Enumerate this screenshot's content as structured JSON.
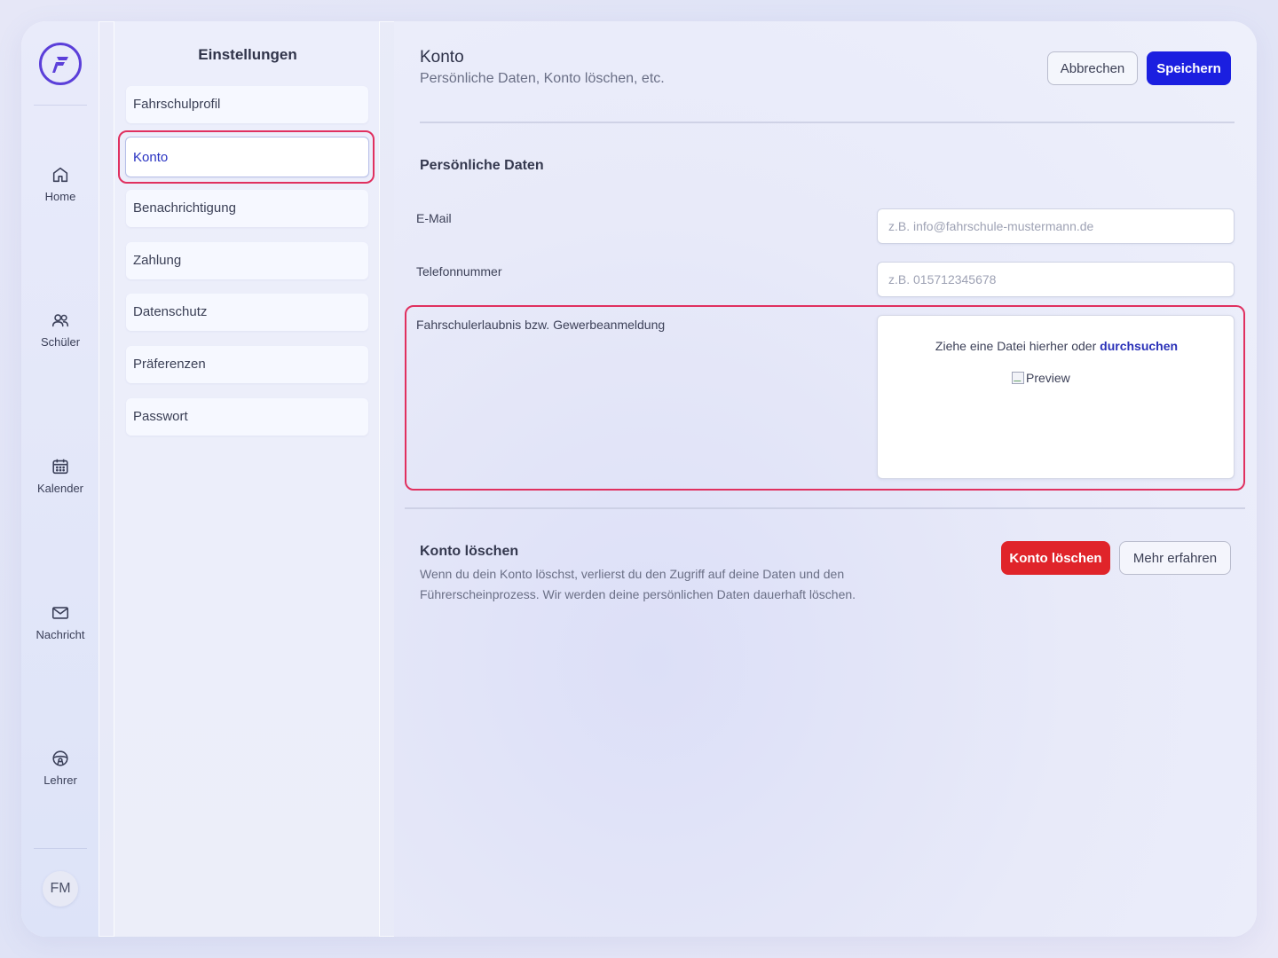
{
  "nav": {
    "items": [
      {
        "label": "Home",
        "icon": "home-icon"
      },
      {
        "label": "Schüler",
        "icon": "users-icon"
      },
      {
        "label": "Kalender",
        "icon": "calendar-icon"
      },
      {
        "label": "Nachricht",
        "icon": "mail-icon"
      },
      {
        "label": "Lehrer",
        "icon": "steering-wheel-icon"
      }
    ],
    "avatar_initials": "FM"
  },
  "settings": {
    "title": "Einstellungen",
    "items": [
      {
        "label": "Fahrschulprofil"
      },
      {
        "label": "Konto",
        "active": true
      },
      {
        "label": "Benachrichtigung"
      },
      {
        "label": "Zahlung"
      },
      {
        "label": "Datenschutz"
      },
      {
        "label": "Präferenzen"
      },
      {
        "label": "Passwort"
      }
    ]
  },
  "main": {
    "title": "Konto",
    "subtitle": "Persönliche Daten, Konto löschen, etc.",
    "cancel_label": "Abbrechen",
    "save_label": "Speichern",
    "personal": {
      "title": "Persönliche Daten",
      "email_label": "E-Mail",
      "email_placeholder": "z.B. info@fahrschule-mustermann.de",
      "phone_label": "Telefonnummer",
      "phone_placeholder": "z.B. 015712345678",
      "upload_label": "Fahrschulerlaubnis bzw. Gewerbeanmeldung",
      "upload_text": "Ziehe eine Datei hierher oder",
      "upload_link": "durchsuchen",
      "preview_alt": "Preview"
    },
    "delete": {
      "title": "Konto löschen",
      "description": "Wenn du dein Konto löschst, verlierst du den Zugriff auf deine Daten und den Führerscheinprozess. Wir werden deine persönlichen Daten dauerhaft löschen.",
      "delete_label": "Konto löschen",
      "more_label": "Mehr erfahren"
    }
  },
  "colors": {
    "primary": "#1b1fe0",
    "danger": "#e0242a",
    "highlight": "#e0305f",
    "brand": "#5b3fd9"
  }
}
